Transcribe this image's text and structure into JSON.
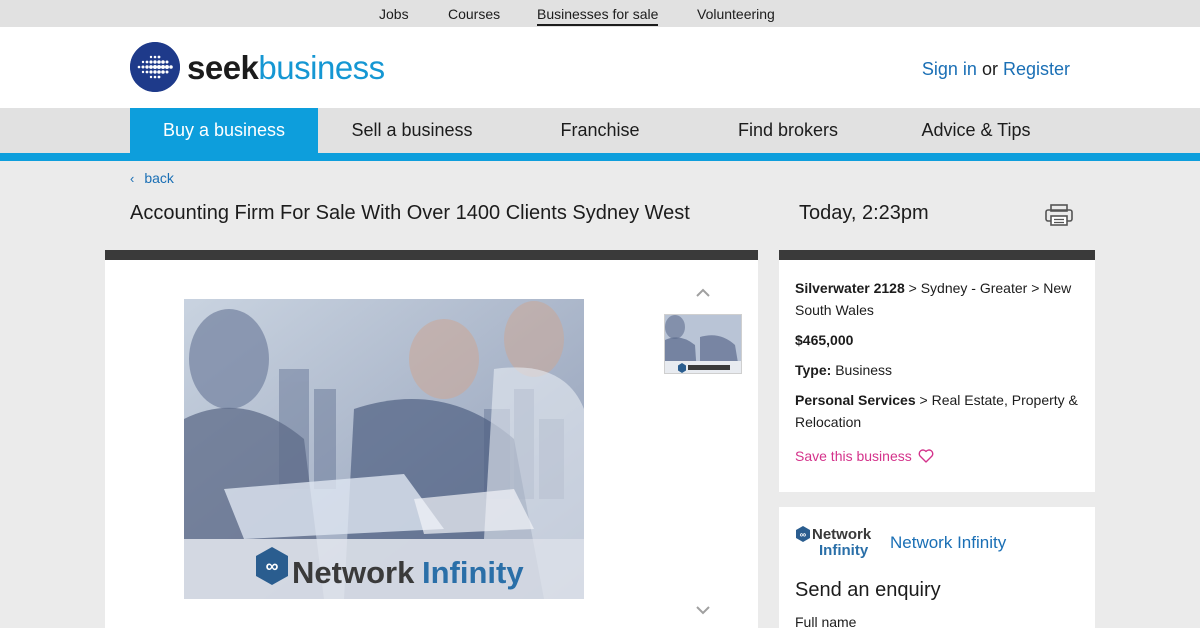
{
  "topnav": {
    "items": [
      "Jobs",
      "Courses",
      "Businesses for sale",
      "Volunteering"
    ]
  },
  "header": {
    "logo_seek": "seek",
    "logo_business": "business",
    "sign_in": "Sign in",
    "or": "or",
    "register": "Register"
  },
  "mainnav": {
    "items": [
      "Buy a business",
      "Sell a business",
      "Franchise",
      "Find brokers",
      "Advice & Tips"
    ]
  },
  "back_label": "back",
  "listing": {
    "title": "Accounting Firm For Sale With Over 1400 Clients Sydney West",
    "datetime": "Today, 2:23pm",
    "location_suburb": "Silverwater 2128",
    "location_path": "> Sydney - Greater > New South Wales",
    "price": "$465,000",
    "type_label": "Type:",
    "type_value": "Business",
    "category": "Personal Services",
    "subcategory": "> Real Estate, Property & Relocation",
    "save_label": "Save this business"
  },
  "photo": {
    "logo_network": "Network",
    "logo_infinity": "Infinity"
  },
  "enquiry": {
    "agent_logo_network": "Network",
    "agent_logo_infinity": "Infinity",
    "agent_name": "Network Infinity",
    "title": "Send an enquiry",
    "full_name_label": "Full name"
  },
  "colors": {
    "brand_blue": "#0d9edc",
    "link_blue": "#1a6fb5",
    "save_pink": "#d4338b",
    "panel_border": "#3a3a3a"
  },
  "icons": [
    "chevron-left-icon",
    "print-icon",
    "chevron-up-icon",
    "chevron-down-icon",
    "heart-icon"
  ]
}
